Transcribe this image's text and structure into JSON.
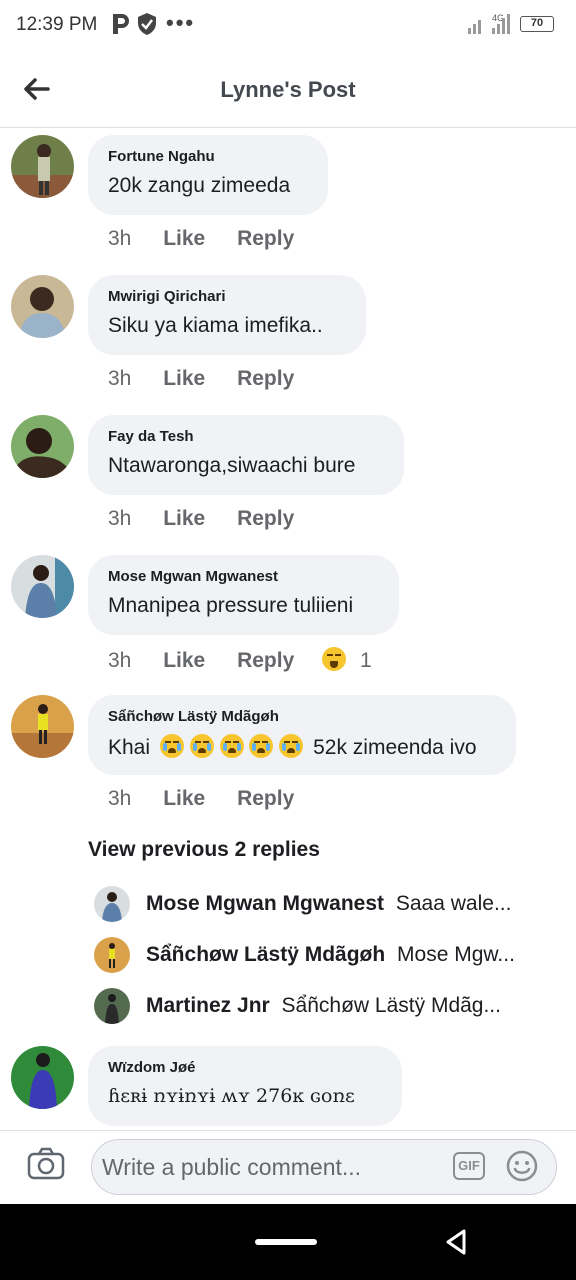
{
  "status": {
    "time": "12:39 PM",
    "network": "4G",
    "battery": "70"
  },
  "header": {
    "title": "Lynne's Post"
  },
  "comments": [
    {
      "author": "Fortune Ngahu",
      "text": "20k zangu zimeeda",
      "time": "3h",
      "like": "Like",
      "reply": "Reply",
      "avatar_color": "#6f7f4a"
    },
    {
      "author": "Mwirigi Qirichari",
      "text": "Siku ya kiama imefika..",
      "time": "3h",
      "like": "Like",
      "reply": "Reply",
      "avatar_color": "#c9b896"
    },
    {
      "author": "Fay da Tesh",
      "text": "Ntawaronga,siwaachi bure",
      "time": "3h",
      "like": "Like",
      "reply": "Reply",
      "avatar_color": "#4a3a30"
    },
    {
      "author": "Mose Mgwan Mgwanest",
      "text": "Mnanipea pressure tuliieni",
      "time": "3h",
      "like": "Like",
      "reply": "Reply",
      "reaction_count": "1",
      "avatar_color": "#5b7fa8"
    },
    {
      "author": "Sẩñchøw Lästÿ Mdãgøh",
      "text_suffix": "52k zimeenda ivo",
      "text_prefix": "Khai",
      "time": "3h",
      "like": "Like",
      "reply": "Reply",
      "avatar_color": "#d9a24a"
    },
    {
      "author": "Wïzdom Jøé",
      "text": "ɦɛʀɨ ռʏɨռʏɨ ʍʏ 276ĸ ɢօռɛ",
      "avatar_color": "#2f8a3a"
    }
  ],
  "view_previous": "View previous 2 replies",
  "replies": [
    {
      "name": "Mose Mgwan Mgwanest",
      "text": "Saaa wale...",
      "avatar_color": "#5b7fa8"
    },
    {
      "name": "Sẩñchøw Lästÿ Mdãgøh",
      "text": "Mose Mgw...",
      "avatar_color": "#d9a24a"
    },
    {
      "name": "Martinez Jnr",
      "text": "Sẩñchøw Lästÿ Mdãg...",
      "avatar_color": "#556b4f"
    }
  ],
  "composer": {
    "placeholder": "Write a public comment...",
    "gif": "GIF"
  }
}
